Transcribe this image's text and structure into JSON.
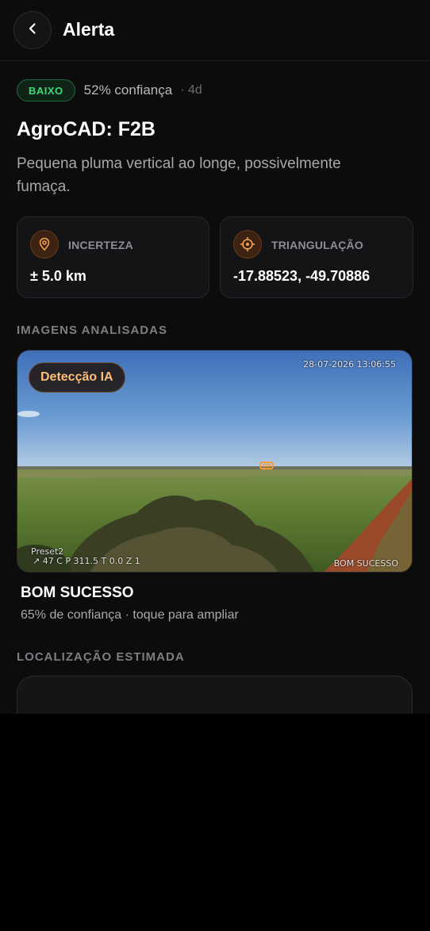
{
  "header": {
    "title": "Alerta",
    "back_icon": "chevron-left-icon"
  },
  "alert": {
    "badge": "BAIXO",
    "confidence": "52% confiança",
    "age": "· 4d",
    "title": "AgroCAD: F2B",
    "description": "Pequena pluma vertical ao longe, possivelmente fumaça."
  },
  "info_cards": [
    {
      "icon": "map-pin-icon",
      "label": "INCERTEZA",
      "value": "± 5.0 km"
    },
    {
      "icon": "crosshair-icon",
      "label": "TRIANGULAÇÃO",
      "value": "-17.88523, -49.70886"
    }
  ],
  "sections": {
    "images": "IMAGENS ANALISADAS",
    "location": "LOCALIZAÇÃO ESTIMADA"
  },
  "image": {
    "chip": "Detecção IA",
    "timestamp": "28-07-2026 13:06:55",
    "preset": "Preset2",
    "ptz": "↗ 47 C P 311.5 T 0.0 Z 1",
    "camera_overlay": "BOM SUCESSO",
    "camera_name": "BOM SUCESSO",
    "caption": "65% de confiança · toque para ampliar"
  },
  "colors": {
    "background": "#0c0c0d",
    "badge_green": "#3ddc74",
    "accent_orange": "#f5a04a",
    "detection_box": "#ff9a2e"
  }
}
